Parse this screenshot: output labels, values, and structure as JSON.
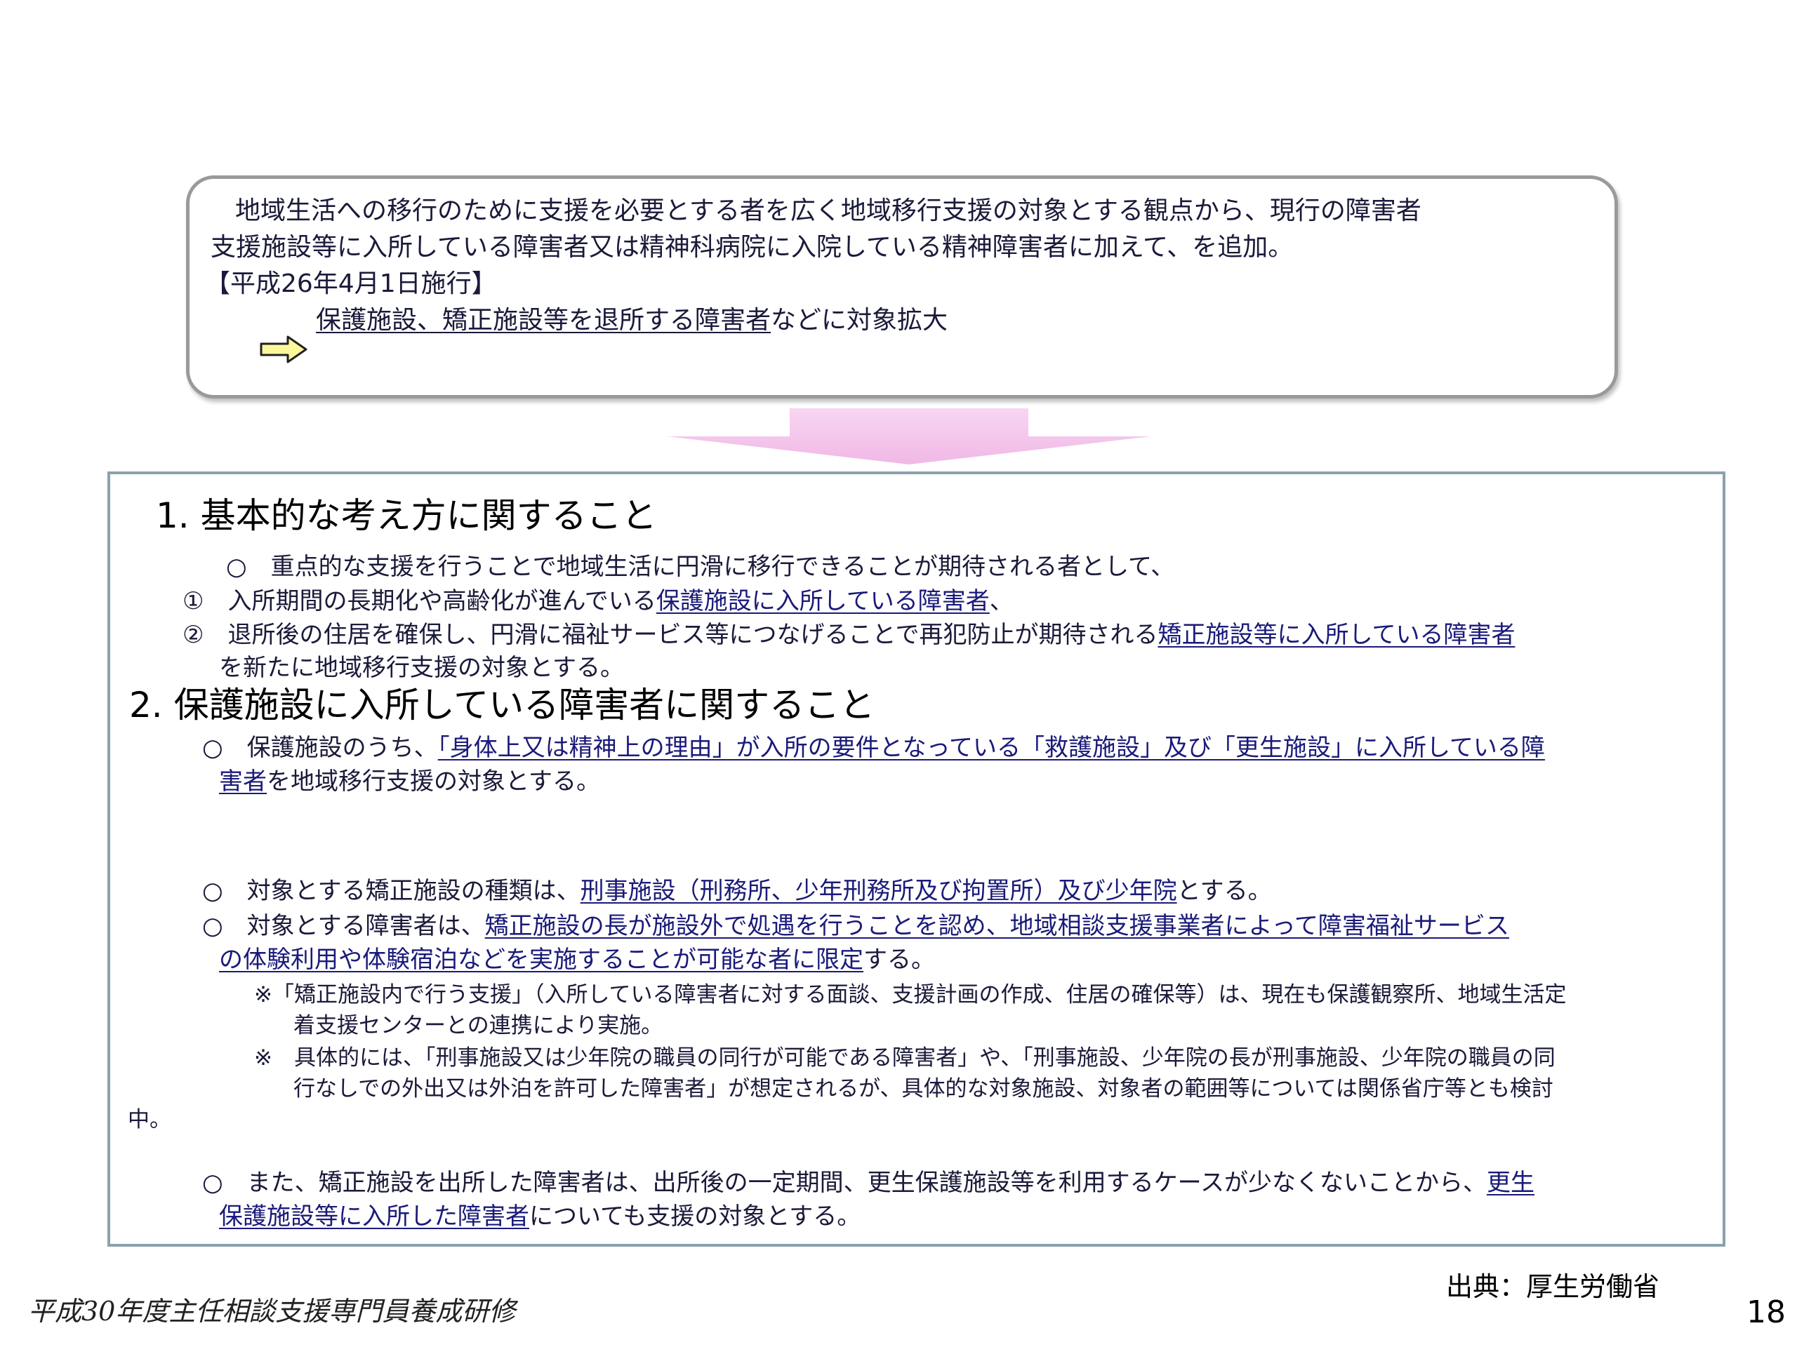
{
  "top_box": {
    "line1": "地域生活への移行のために支援を必要とする者を広く地域移行支援の対象とする観点から、現行の障害者",
    "line2": "支援施設等に入所している障害者又は精神科病院に入院している精神障害者に加えて、を追加。",
    "line3": "【平成26年4月1日施行】",
    "line4_underlined": "保護施設、矯正施設等を退所する障害者",
    "line4_rest": "などに対象拡大"
  },
  "section1": {
    "heading": "1. 基本的な考え方に関すること",
    "intro": "○　重点的な支援を行うことで地域生活に円滑に移行できることが期待される者として、",
    "item1_prefix": "①　入所期間の長期化や高齢化が進んでいる",
    "item1_underlined": "保護施設に入所している障害者",
    "item1_suffix": "、",
    "item2_prefix": "②　退所後の住居を確保し、円滑に福祉サービス等につなげることで再犯防止が期待される",
    "item2_underlined": "矯正施設等に入所している障害者",
    "item2_cont": "を新たに地域移行支援の対象とする。"
  },
  "section2": {
    "heading": "2. 保護施設に入所している障害者に関すること",
    "p1_prefix": "○　保護施設のうち、",
    "p1_underlined": "「身体上又は精神上の理由」が入所の要件となっている「救護施設」及び「更生施設」に入所している障",
    "p1_cont_underlined": "害者",
    "p1_cont_rest": "を地域移行支援の対象とする。",
    "p2_prefix": "○　対象とする矯正施設の種類は、",
    "p2_underlined": "刑事施設（刑務所、少年刑務所及び拘置所）及び少年院",
    "p2_suffix": "とする。",
    "p3_prefix": "○　対象とする障害者は、",
    "p3_underlined": "矯正施設の長が施設外で処遇を行うことを認め、地域相談支援事業者によって障害福祉サービス",
    "p3_cont_underlined": "の体験利用や体験宿泊などを実施することが可能な者に限定",
    "p3_cont_rest": "する。",
    "note1_line1": "※「矯正施設内で行う支援」（入所している障害者に対する面談、支援計画の作成、住居の確保等）は、現在も保護観察所、地域生活定",
    "note1_line2": "着支援センターとの連携により実施。",
    "note2_line1": "※　具体的には、「刑事施設又は少年院の職員の同行が可能である障害者」や、「刑事施設、少年院の長が刑事施設、少年院の職員の同",
    "note2_line2": "行なしでの外出又は外泊を許可した障害者」が想定されるが、具体的な対象施設、対象者の範囲等については関係省庁等とも検討",
    "note2_line3": "中。",
    "p4_prefix": "○　また、矯正施設を出所した障害者は、出所後の一定期間、更生保護施設等を利用するケースが少なくないことから、",
    "p4_underlined": "更生",
    "p4_cont_underlined": "保護施設等に入所した障害者",
    "p4_cont_rest": "についても支援の対象とする。"
  },
  "footer": {
    "source": "出典：厚生労働省",
    "title": "平成30年度主任相談支援専門員養成研修",
    "page_number": "18"
  },
  "icons": {
    "right_arrow": "yellow-right-arrow-icon",
    "down_arrow": "pink-down-arrow-icon"
  },
  "colors": {
    "arrow_fill": "#fcf89a",
    "down_arrow_fill": "#f4c4ec",
    "main_border": "#8aa2ac",
    "text_blue": "#1a1a7a"
  }
}
